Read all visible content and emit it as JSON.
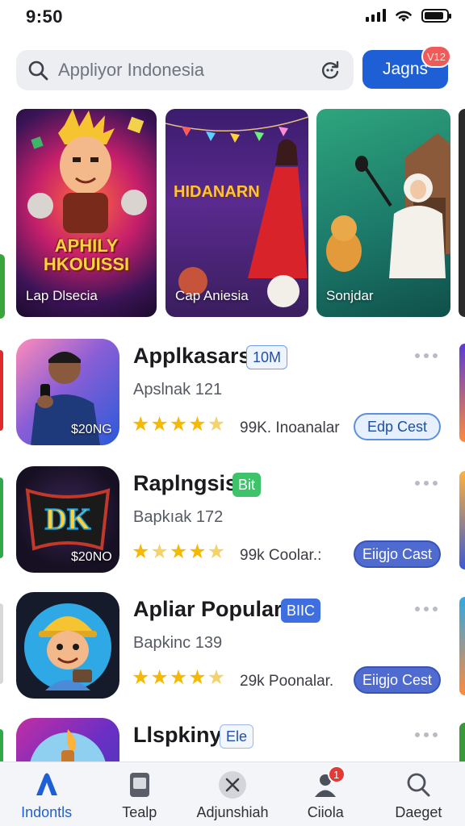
{
  "status_bar": {
    "time": "9:50",
    "battery_level": 0.9
  },
  "search": {
    "placeholder": "Appliyor Indonesia",
    "action_button_label": "Jagns",
    "action_badge": "V12"
  },
  "carousel": {
    "banners": [
      {
        "label": "Lap Dlsecia",
        "art_text": "APHILY HKOUISSI"
      },
      {
        "label": "Cap Aniesia",
        "art_text": "HIDANARN"
      },
      {
        "label": "Sonjdar"
      }
    ]
  },
  "apps": [
    {
      "name": "Applkasars",
      "tag": "10M",
      "subtitle": "Apslnak 121",
      "price": "$20NG",
      "rating": 4.5,
      "meta": "99K. Inoanalar",
      "button": "Edp Cest",
      "icon": "person-holding-phone-icon"
    },
    {
      "name": "Raplngsis",
      "tag": "Bit",
      "subtitle": "Bapkıak 172",
      "price": "$20NO",
      "rating": 4.5,
      "meta": "99k Coolar.:",
      "button": "Eiigjo Cast",
      "icon": "dk-logo-icon"
    },
    {
      "name": "Apliar Popular",
      "tag": "BIIC",
      "subtitle": "Bapkinc 139",
      "rating": 4.5,
      "meta": "29k Poonalar.",
      "button": "Eiigjo Cest",
      "icon": "builder-character-icon"
    },
    {
      "name": "Llspkiny",
      "tag": "Ele",
      "icon": "torch-icon"
    }
  ],
  "bottom_nav": [
    {
      "label": "Indontls",
      "icon": "apps-a-icon",
      "active": true
    },
    {
      "label": "Tealp",
      "icon": "tablet-icon"
    },
    {
      "label": "Adjunshiah",
      "icon": "close-circle-icon"
    },
    {
      "label": "Ciiola",
      "icon": "person-icon",
      "badge": "1"
    },
    {
      "label": "Daeget",
      "icon": "search-icon"
    }
  ],
  "colors": {
    "accent": "#1f5fd6",
    "star": "#f6b800",
    "badge_red": "#e53935"
  }
}
